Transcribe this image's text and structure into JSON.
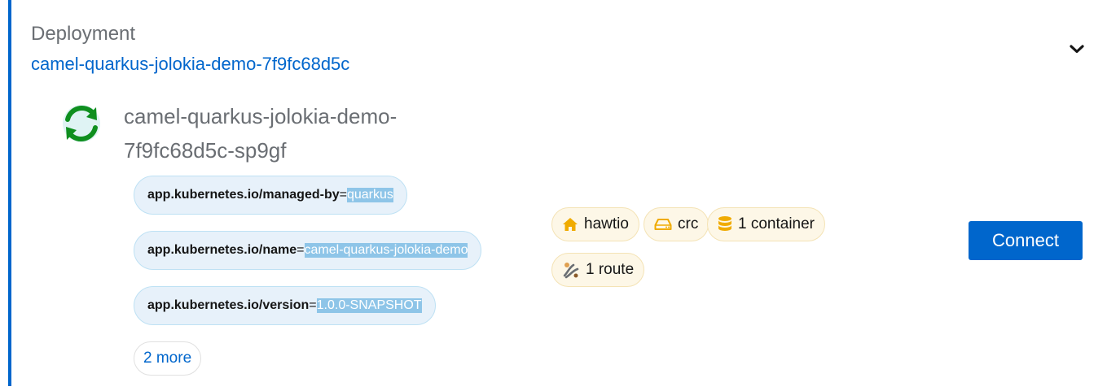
{
  "deployment": {
    "kind": "Deployment",
    "name": "camel-quarkus-jolokia-demo-7f9fc68d5c"
  },
  "pod": {
    "name": "camel-quarkus-jolokia-demo-7f9fc68d5c-sp9gf",
    "name_line1": "camel-quarkus-jolokia-demo-",
    "name_line2": "7f9fc68d5c-sp9gf",
    "status_icon": "sync-icon",
    "labels": [
      {
        "key": "app.kubernetes.io/managed-by",
        "eq": "=",
        "value": "quarkus"
      },
      {
        "key": "app.kubernetes.io/name",
        "eq": "=",
        "value": "camel-quarkus-jolokia-demo"
      },
      {
        "key": "app.kubernetes.io/version",
        "eq": "=",
        "value": "1.0.0-SNAPSHOT"
      }
    ],
    "more_labels": "2 more",
    "badges": {
      "namespace": {
        "icon": "home-icon",
        "label": "hawtio"
      },
      "node": {
        "icon": "hdd-icon",
        "label": "crc"
      },
      "containers": {
        "icon": "database-icon",
        "label": "1 container"
      },
      "routes": {
        "icon": "route-icon",
        "label": "1 route"
      }
    }
  },
  "actions": {
    "connect_label": "Connect"
  },
  "colors": {
    "accent": "#0066cc",
    "label_bg": "#e7f1fa",
    "badge_bg": "#fdf7e7",
    "badge_icon": "#f0ab00",
    "status_green": "#0f8f1f"
  }
}
